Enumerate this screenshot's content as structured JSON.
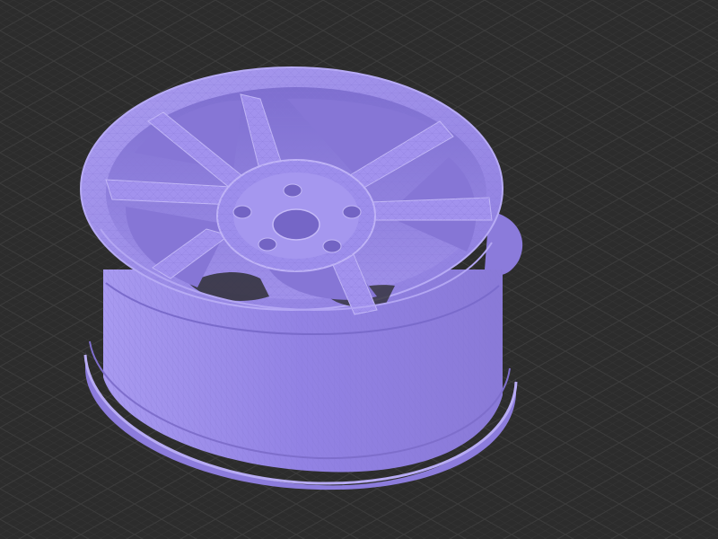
{
  "viewport": {
    "background": "#2c2c2c",
    "grid_color_minor": "#3a3a3a",
    "grid_color_major": "#4a4a4a",
    "grid_visible": true
  },
  "model": {
    "object": "alloy-wheel",
    "render_mode": "shaded-with-wireframe",
    "material_color": "#9b89e6",
    "shadow_color": "#7f6fd0",
    "highlight_color": "#c8bdf7",
    "spoke_count": 7,
    "lug_hole_count": 5
  }
}
